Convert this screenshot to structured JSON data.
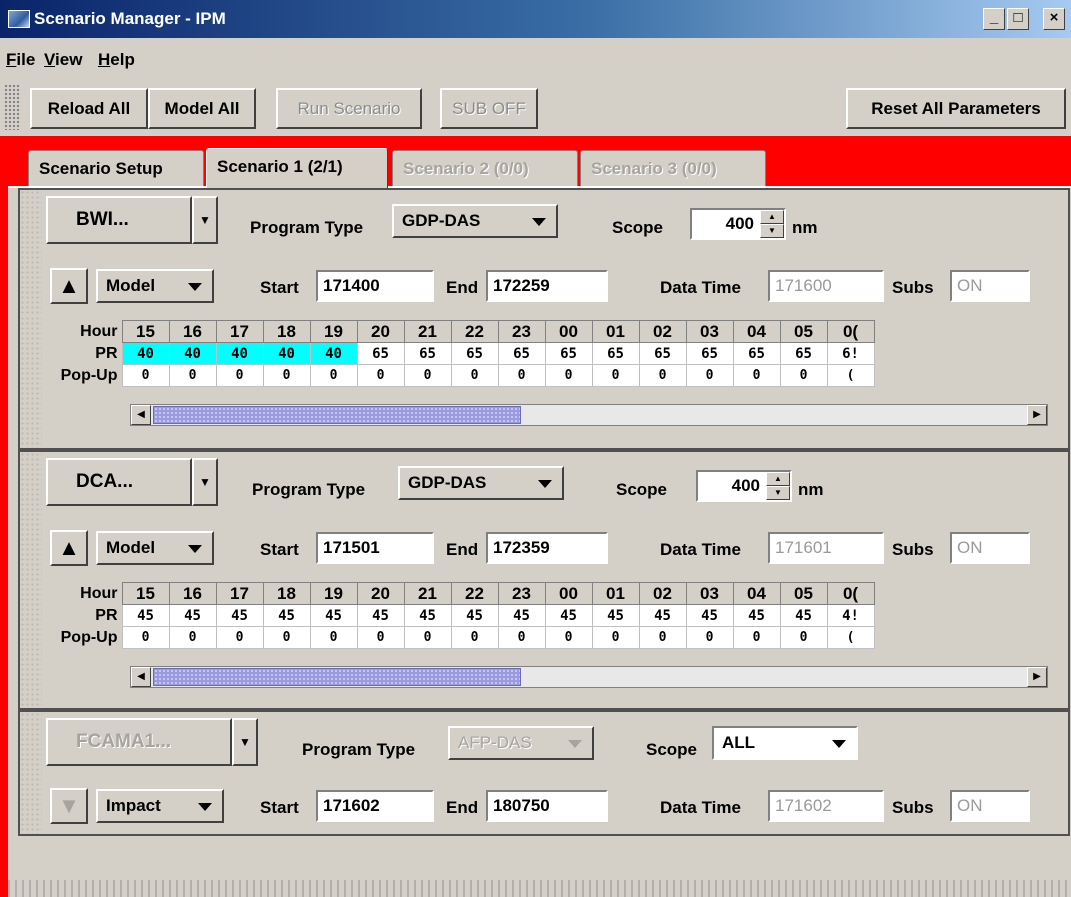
{
  "window": {
    "title": "Scenario Manager - IPM",
    "minimize": "_",
    "maximize": "□",
    "close": "×"
  },
  "menu": [
    {
      "u": "F",
      "rest": "ile"
    },
    {
      "u": "V",
      "rest": "iew"
    },
    {
      "u": "H",
      "rest": "elp"
    }
  ],
  "toolbar": {
    "reload_all": "Reload All",
    "model_all": "Model All",
    "run_scenario": "Run Scenario",
    "sub_off": "SUB OFF",
    "reset_all": "Reset All Parameters"
  },
  "tabs": [
    "Scenario Setup",
    "Scenario 1 (2/1)",
    "Scenario 2 (0/0)",
    "Scenario 3 (0/0)"
  ],
  "labels": {
    "program_type": "Program Type",
    "scope": "Scope",
    "nm": "nm",
    "start": "Start",
    "end": "End",
    "data_time": "Data Time",
    "subs": "Subs",
    "hour": "Hour",
    "pr": "PR",
    "popup": "Pop-Up"
  },
  "hours": [
    "15",
    "16",
    "17",
    "18",
    "19",
    "20",
    "21",
    "22",
    "23",
    "00",
    "01",
    "02",
    "03",
    "04",
    "05",
    "0("
  ],
  "panels": [
    {
      "airport": "BWI...",
      "program_type": "GDP-DAS",
      "scope": "400",
      "mode": "Model",
      "start": "171400",
      "end": "172259",
      "data_time": "171600",
      "subs": "ON",
      "pr": [
        "40",
        "40",
        "40",
        "40",
        "40",
        "65",
        "65",
        "65",
        "65",
        "65",
        "65",
        "65",
        "65",
        "65",
        "65",
        "6!"
      ],
      "popup": [
        "0",
        "0",
        "0",
        "0",
        "0",
        "0",
        "0",
        "0",
        "0",
        "0",
        "0",
        "0",
        "0",
        "0",
        "0",
        "("
      ]
    },
    {
      "airport": "DCA...",
      "program_type": "GDP-DAS",
      "scope": "400",
      "mode": "Model",
      "start": "171501",
      "end": "172359",
      "data_time": "171601",
      "subs": "ON",
      "pr": [
        "45",
        "45",
        "45",
        "45",
        "45",
        "45",
        "45",
        "45",
        "45",
        "45",
        "45",
        "45",
        "45",
        "45",
        "45",
        "4!"
      ],
      "popup": [
        "0",
        "0",
        "0",
        "0",
        "0",
        "0",
        "0",
        "0",
        "0",
        "0",
        "0",
        "0",
        "0",
        "0",
        "0",
        "("
      ]
    },
    {
      "airport": "FCAMA1...",
      "program_type": "AFP-DAS",
      "scope": "ALL",
      "mode": "Impact",
      "start": "171602",
      "end": "180750",
      "data_time": "171602",
      "subs": "ON"
    }
  ]
}
